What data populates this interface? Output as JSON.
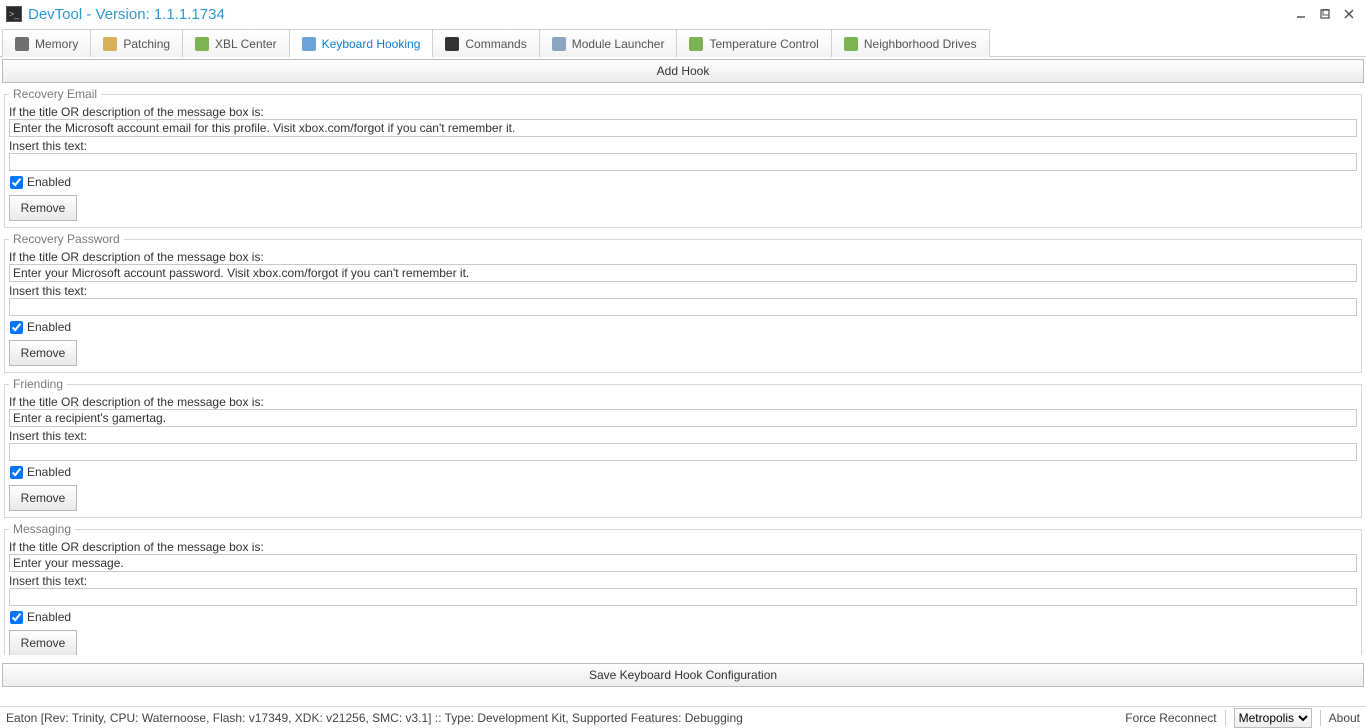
{
  "window": {
    "title": "DevTool - Version: 1.1.1.1734"
  },
  "tabs": [
    {
      "label": "Memory"
    },
    {
      "label": "Patching"
    },
    {
      "label": "XBL Center"
    },
    {
      "label": "Keyboard Hooking"
    },
    {
      "label": "Commands"
    },
    {
      "label": "Module Launcher"
    },
    {
      "label": "Temperature Control"
    },
    {
      "label": "Neighborhood Drives"
    }
  ],
  "buttons": {
    "add_hook": "Add Hook",
    "save_config": "Save Keyboard Hook Configuration",
    "remove": "Remove",
    "force_reconnect": "Force Reconnect",
    "about": "About"
  },
  "labels": {
    "if_title": "If the title OR description of the message box is:",
    "insert_text": "Insert this text:",
    "enabled": "Enabled"
  },
  "hooks": [
    {
      "legend": "Recovery Email",
      "match_value": "Enter the Microsoft account email for this profile. Visit xbox.com/forgot if you can't remember it.",
      "insert_value": "",
      "enabled": true
    },
    {
      "legend": "Recovery Password",
      "match_value": "Enter your Microsoft account password. Visit xbox.com/forgot if you can't remember it.",
      "insert_value": "",
      "enabled": true
    },
    {
      "legend": "Friending",
      "match_value": "Enter a recipient's gamertag.",
      "insert_value": "",
      "enabled": true
    },
    {
      "legend": "Messaging",
      "match_value": "Enter your message.",
      "insert_value": "",
      "enabled": true
    }
  ],
  "statusbar": {
    "text": "Eaton [Rev: Trinity, CPU: Waternoose, Flash: v17349, XDK: v21256, SMC: v3.1] :: Type: Development Kit, Supported Features: Debugging",
    "dropdown_selected": "Metropolis"
  }
}
